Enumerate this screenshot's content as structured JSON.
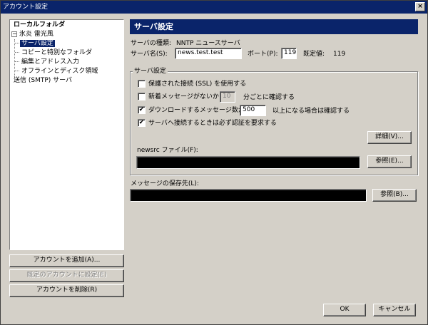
{
  "window": {
    "title": "アカウント設定",
    "close_glyph": "×"
  },
  "tree": {
    "items": [
      {
        "label": "ローカルフォルダ"
      },
      {
        "label": "氷炎 雷光風",
        "expander": "−"
      },
      {
        "label": "サーバ設定"
      },
      {
        "label": "コピーと特別なフォルダ"
      },
      {
        "label": "編集とアドレス入力"
      },
      {
        "label": "オフラインとディスク領域"
      },
      {
        "label": "送信 (SMTP) サーバ"
      }
    ]
  },
  "left_buttons": {
    "add": "アカウントを追加(A)...",
    "set_default": "既定のアカウントに設定(E)",
    "remove": "アカウントを削除(R)"
  },
  "panel": {
    "header": "サーバ設定",
    "server_type_label": "サーバの種類:",
    "server_type_value": "NNTP ニュースサーバ",
    "server_name_label": "サーバ名(S):",
    "server_name_value": "news.test.test",
    "port_label": "ポート(P):",
    "port_value": "119",
    "default_label": "既定値:",
    "default_value": "119"
  },
  "group": {
    "title": "サーバ設定",
    "ssl_label": "保護された接続 (SSL) を使用する",
    "check_new_prefix": "新着メッセージがないか",
    "check_new_minutes": "10",
    "check_new_suffix": "分ごとに確認する",
    "download_prefix": "ダウンロードするメッセージ数が",
    "download_count": "500",
    "download_suffix": "以上になる場合は確認する",
    "auth_label": "サーバへ接続するときは必ず認証を要求する",
    "advanced_button": "詳細(V)...",
    "newsrc_label": "newsrc ファイル(F):",
    "newsrc_browse": "参照(E)...",
    "check_mark": "✔"
  },
  "storage": {
    "label": "メッセージの保存先(L):",
    "browse": "参照(B)..."
  },
  "footer": {
    "ok": "OK",
    "cancel": "キャンセル"
  }
}
